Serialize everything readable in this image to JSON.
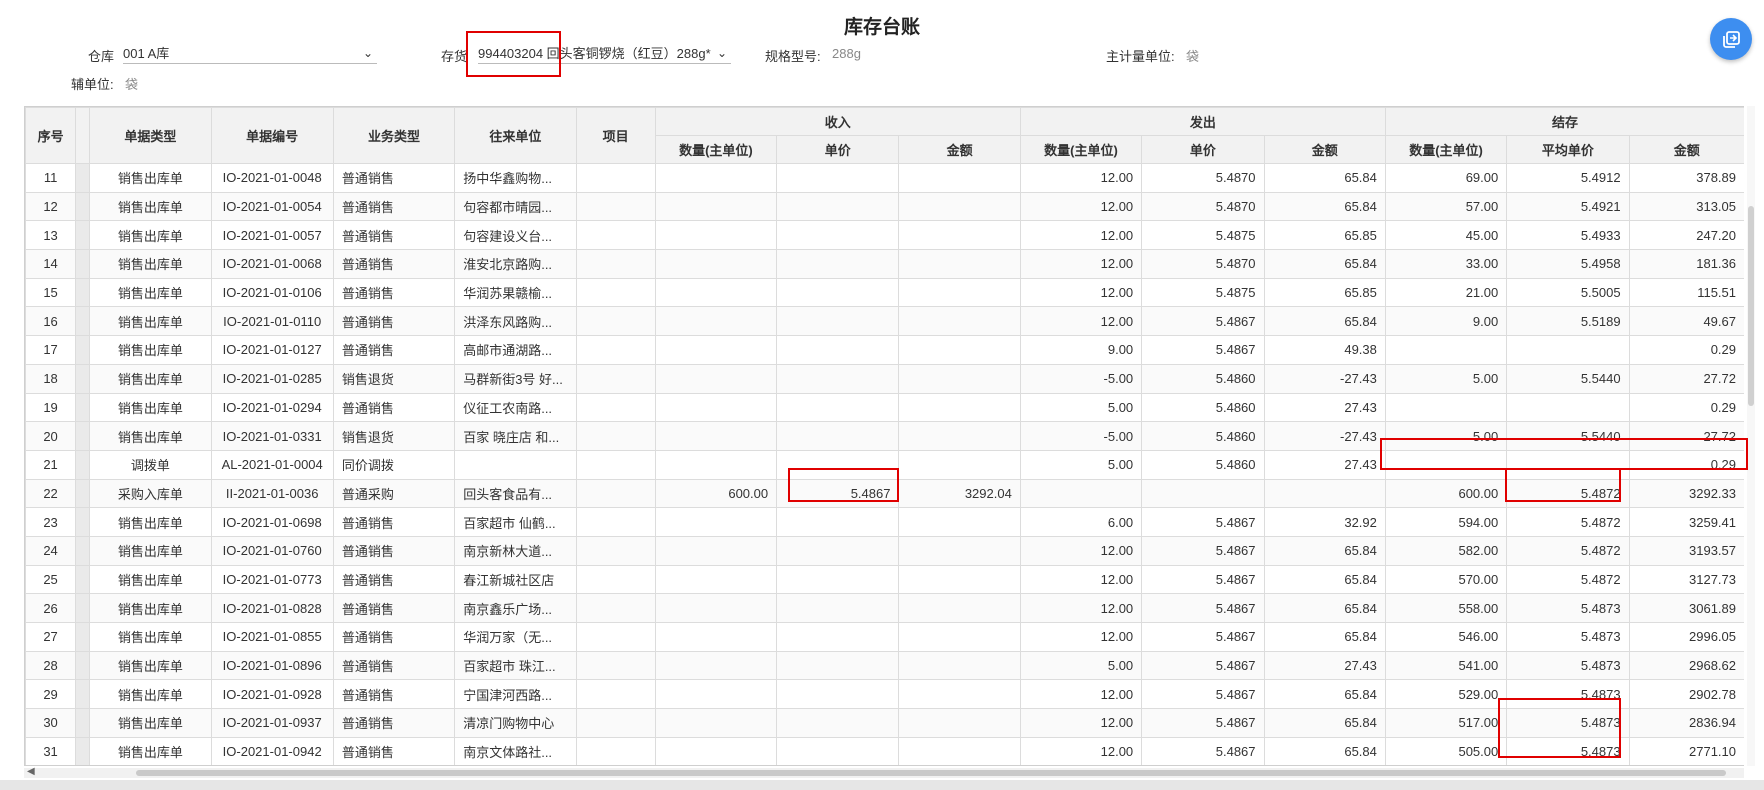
{
  "page": {
    "title": "库存台账"
  },
  "filters": {
    "warehouse_label": "仓库",
    "warehouse_value": "001 A库",
    "stock_label": "存货",
    "stock_value": "994403204 回头客铜锣烧（红豆）288g*",
    "spec_label": "规格型号:",
    "spec_value": "288g",
    "main_unit_label": "主计量单位:",
    "main_unit_value": "袋",
    "aux_unit_label": "辅单位:",
    "aux_unit_value": "袋"
  },
  "table": {
    "headers": {
      "seq": "序号",
      "doc_type": "单据类型",
      "doc_no": "单据编号",
      "biz_type": "业务类型",
      "partner": "往来单位",
      "project": "项目",
      "income": "收入",
      "outgo": "发出",
      "balance": "结存",
      "qty": "数量(主单位)",
      "price": "单价",
      "amount": "金额",
      "avg_price": "平均单价"
    },
    "rows": [
      {
        "seq": "11",
        "type": "销售出库单",
        "no": "IO-2021-01-0048",
        "biz": "普通销售",
        "partner": "扬中华鑫购物...",
        "in_qty": "",
        "in_price": "",
        "in_amt": "",
        "out_qty": "12.00",
        "out_price": "5.4870",
        "out_amt": "65.84",
        "bal_qty": "69.00",
        "bal_price": "5.4912",
        "bal_amt": "378.89"
      },
      {
        "seq": "12",
        "type": "销售出库单",
        "no": "IO-2021-01-0054",
        "biz": "普通销售",
        "partner": "句容都市晴园...",
        "in_qty": "",
        "in_price": "",
        "in_amt": "",
        "out_qty": "12.00",
        "out_price": "5.4870",
        "out_amt": "65.84",
        "bal_qty": "57.00",
        "bal_price": "5.4921",
        "bal_amt": "313.05"
      },
      {
        "seq": "13",
        "type": "销售出库单",
        "no": "IO-2021-01-0057",
        "biz": "普通销售",
        "partner": "句容建设义台...",
        "in_qty": "",
        "in_price": "",
        "in_amt": "",
        "out_qty": "12.00",
        "out_price": "5.4875",
        "out_amt": "65.85",
        "bal_qty": "45.00",
        "bal_price": "5.4933",
        "bal_amt": "247.20"
      },
      {
        "seq": "14",
        "type": "销售出库单",
        "no": "IO-2021-01-0068",
        "biz": "普通销售",
        "partner": "淮安北京路购...",
        "in_qty": "",
        "in_price": "",
        "in_amt": "",
        "out_qty": "12.00",
        "out_price": "5.4870",
        "out_amt": "65.84",
        "bal_qty": "33.00",
        "bal_price": "5.4958",
        "bal_amt": "181.36"
      },
      {
        "seq": "15",
        "type": "销售出库单",
        "no": "IO-2021-01-0106",
        "biz": "普通销售",
        "partner": "华润苏果赣榆...",
        "in_qty": "",
        "in_price": "",
        "in_amt": "",
        "out_qty": "12.00",
        "out_price": "5.4875",
        "out_amt": "65.85",
        "bal_qty": "21.00",
        "bal_price": "5.5005",
        "bal_amt": "115.51"
      },
      {
        "seq": "16",
        "type": "销售出库单",
        "no": "IO-2021-01-0110",
        "biz": "普通销售",
        "partner": "洪泽东风路购...",
        "in_qty": "",
        "in_price": "",
        "in_amt": "",
        "out_qty": "12.00",
        "out_price": "5.4867",
        "out_amt": "65.84",
        "bal_qty": "9.00",
        "bal_price": "5.5189",
        "bal_amt": "49.67"
      },
      {
        "seq": "17",
        "type": "销售出库单",
        "no": "IO-2021-01-0127",
        "biz": "普通销售",
        "partner": "高邮市通湖路...",
        "in_qty": "",
        "in_price": "",
        "in_amt": "",
        "out_qty": "9.00",
        "out_price": "5.4867",
        "out_amt": "49.38",
        "bal_qty": "",
        "bal_price": "",
        "bal_amt": "0.29"
      },
      {
        "seq": "18",
        "type": "销售出库单",
        "no": "IO-2021-01-0285",
        "biz": "销售退货",
        "partner": "马群新街3号 好...",
        "in_qty": "",
        "in_price": "",
        "in_amt": "",
        "out_qty": "-5.00",
        "out_price": "5.4860",
        "out_amt": "-27.43",
        "bal_qty": "5.00",
        "bal_price": "5.5440",
        "bal_amt": "27.72"
      },
      {
        "seq": "19",
        "type": "销售出库单",
        "no": "IO-2021-01-0294",
        "biz": "普通销售",
        "partner": "仪征工农南路...",
        "in_qty": "",
        "in_price": "",
        "in_amt": "",
        "out_qty": "5.00",
        "out_price": "5.4860",
        "out_amt": "27.43",
        "bal_qty": "",
        "bal_price": "",
        "bal_amt": "0.29"
      },
      {
        "seq": "20",
        "type": "销售出库单",
        "no": "IO-2021-01-0331",
        "biz": "销售退货",
        "partner": "百家 晓庄店 和...",
        "in_qty": "",
        "in_price": "",
        "in_amt": "",
        "out_qty": "-5.00",
        "out_price": "5.4860",
        "out_amt": "-27.43",
        "bal_qty": "5.00",
        "bal_price": "5.5440",
        "bal_amt": "27.72"
      },
      {
        "seq": "21",
        "type": "调拨单",
        "no": "AL-2021-01-0004",
        "biz": "同价调拨",
        "partner": "",
        "in_qty": "",
        "in_price": "",
        "in_amt": "",
        "out_qty": "5.00",
        "out_price": "5.4860",
        "out_amt": "27.43",
        "bal_qty": "",
        "bal_price": "",
        "bal_amt": "0.29"
      },
      {
        "seq": "22",
        "type": "采购入库单",
        "no": "II-2021-01-0036",
        "biz": "普通采购",
        "partner": "回头客食品有...",
        "in_qty": "600.00",
        "in_price": "5.4867",
        "in_amt": "3292.04",
        "out_qty": "",
        "out_price": "",
        "out_amt": "",
        "bal_qty": "600.00",
        "bal_price": "5.4872",
        "bal_amt": "3292.33"
      },
      {
        "seq": "23",
        "type": "销售出库单",
        "no": "IO-2021-01-0698",
        "biz": "普通销售",
        "partner": "百家超市 仙鹤...",
        "in_qty": "",
        "in_price": "",
        "in_amt": "",
        "out_qty": "6.00",
        "out_price": "5.4867",
        "out_amt": "32.92",
        "bal_qty": "594.00",
        "bal_price": "5.4872",
        "bal_amt": "3259.41"
      },
      {
        "seq": "24",
        "type": "销售出库单",
        "no": "IO-2021-01-0760",
        "biz": "普通销售",
        "partner": "南京新林大道...",
        "in_qty": "",
        "in_price": "",
        "in_amt": "",
        "out_qty": "12.00",
        "out_price": "5.4867",
        "out_amt": "65.84",
        "bal_qty": "582.00",
        "bal_price": "5.4872",
        "bal_amt": "3193.57"
      },
      {
        "seq": "25",
        "type": "销售出库单",
        "no": "IO-2021-01-0773",
        "biz": "普通销售",
        "partner": "春江新城社区店",
        "in_qty": "",
        "in_price": "",
        "in_amt": "",
        "out_qty": "12.00",
        "out_price": "5.4867",
        "out_amt": "65.84",
        "bal_qty": "570.00",
        "bal_price": "5.4872",
        "bal_amt": "3127.73"
      },
      {
        "seq": "26",
        "type": "销售出库单",
        "no": "IO-2021-01-0828",
        "biz": "普通销售",
        "partner": "南京鑫乐广场...",
        "in_qty": "",
        "in_price": "",
        "in_amt": "",
        "out_qty": "12.00",
        "out_price": "5.4867",
        "out_amt": "65.84",
        "bal_qty": "558.00",
        "bal_price": "5.4873",
        "bal_amt": "3061.89"
      },
      {
        "seq": "27",
        "type": "销售出库单",
        "no": "IO-2021-01-0855",
        "biz": "普通销售",
        "partner": "华润万家（无...",
        "in_qty": "",
        "in_price": "",
        "in_amt": "",
        "out_qty": "12.00",
        "out_price": "5.4867",
        "out_amt": "65.84",
        "bal_qty": "546.00",
        "bal_price": "5.4873",
        "bal_amt": "2996.05"
      },
      {
        "seq": "28",
        "type": "销售出库单",
        "no": "IO-2021-01-0896",
        "biz": "普通销售",
        "partner": "百家超市 珠江...",
        "in_qty": "",
        "in_price": "",
        "in_amt": "",
        "out_qty": "5.00",
        "out_price": "5.4867",
        "out_amt": "27.43",
        "bal_qty": "541.00",
        "bal_price": "5.4873",
        "bal_amt": "2968.62"
      },
      {
        "seq": "29",
        "type": "销售出库单",
        "no": "IO-2021-01-0928",
        "biz": "普通销售",
        "partner": "宁国津河西路...",
        "in_qty": "",
        "in_price": "",
        "in_amt": "",
        "out_qty": "12.00",
        "out_price": "5.4867",
        "out_amt": "65.84",
        "bal_qty": "529.00",
        "bal_price": "5.4873",
        "bal_amt": "2902.78"
      },
      {
        "seq": "30",
        "type": "销售出库单",
        "no": "IO-2021-01-0937",
        "biz": "普通销售",
        "partner": "清凉门购物中心",
        "in_qty": "",
        "in_price": "",
        "in_amt": "",
        "out_qty": "12.00",
        "out_price": "5.4867",
        "out_amt": "65.84",
        "bal_qty": "517.00",
        "bal_price": "5.4873",
        "bal_amt": "2836.94"
      },
      {
        "seq": "31",
        "type": "销售出库单",
        "no": "IO-2021-01-0942",
        "biz": "普通销售",
        "partner": "南京文体路社...",
        "in_qty": "",
        "in_price": "",
        "in_amt": "",
        "out_qty": "12.00",
        "out_price": "5.4867",
        "out_amt": "65.84",
        "bal_qty": "505.00",
        "bal_price": "5.4873",
        "bal_amt": "2771.10"
      }
    ]
  },
  "colors": {
    "link": "#2b3ec8",
    "negative": "#e02020",
    "highlight": "#e00000",
    "fab": "#3d8ef0"
  },
  "icons": {
    "fab": "share-export-icon",
    "dropdown": "chevron-down-icon"
  }
}
